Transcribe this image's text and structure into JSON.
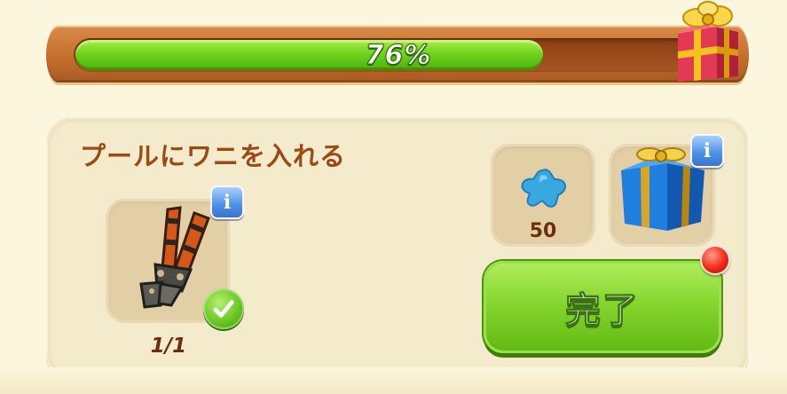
{
  "progress": {
    "percent": 76,
    "label": "76%"
  },
  "quest": {
    "title": "プールにワニを入れる",
    "required_item": {
      "icon": "bolt-cutters-icon",
      "count_label": "1/1",
      "completed": true
    },
    "rewards": [
      {
        "icon": "blue-star-gem-icon",
        "amount": "50"
      },
      {
        "icon": "blue-gift-box-icon"
      }
    ],
    "complete_button": {
      "label": "完了"
    }
  },
  "icons": {
    "info": "i",
    "check": "check-icon",
    "top_gift": "red-gift-box-icon",
    "notification": "red-dot-icon"
  },
  "colors": {
    "progress_fill": "#6fd31d",
    "title_text": "#9c4a15",
    "button_green": "#86d62f",
    "info_blue": "#4c8fe6"
  }
}
